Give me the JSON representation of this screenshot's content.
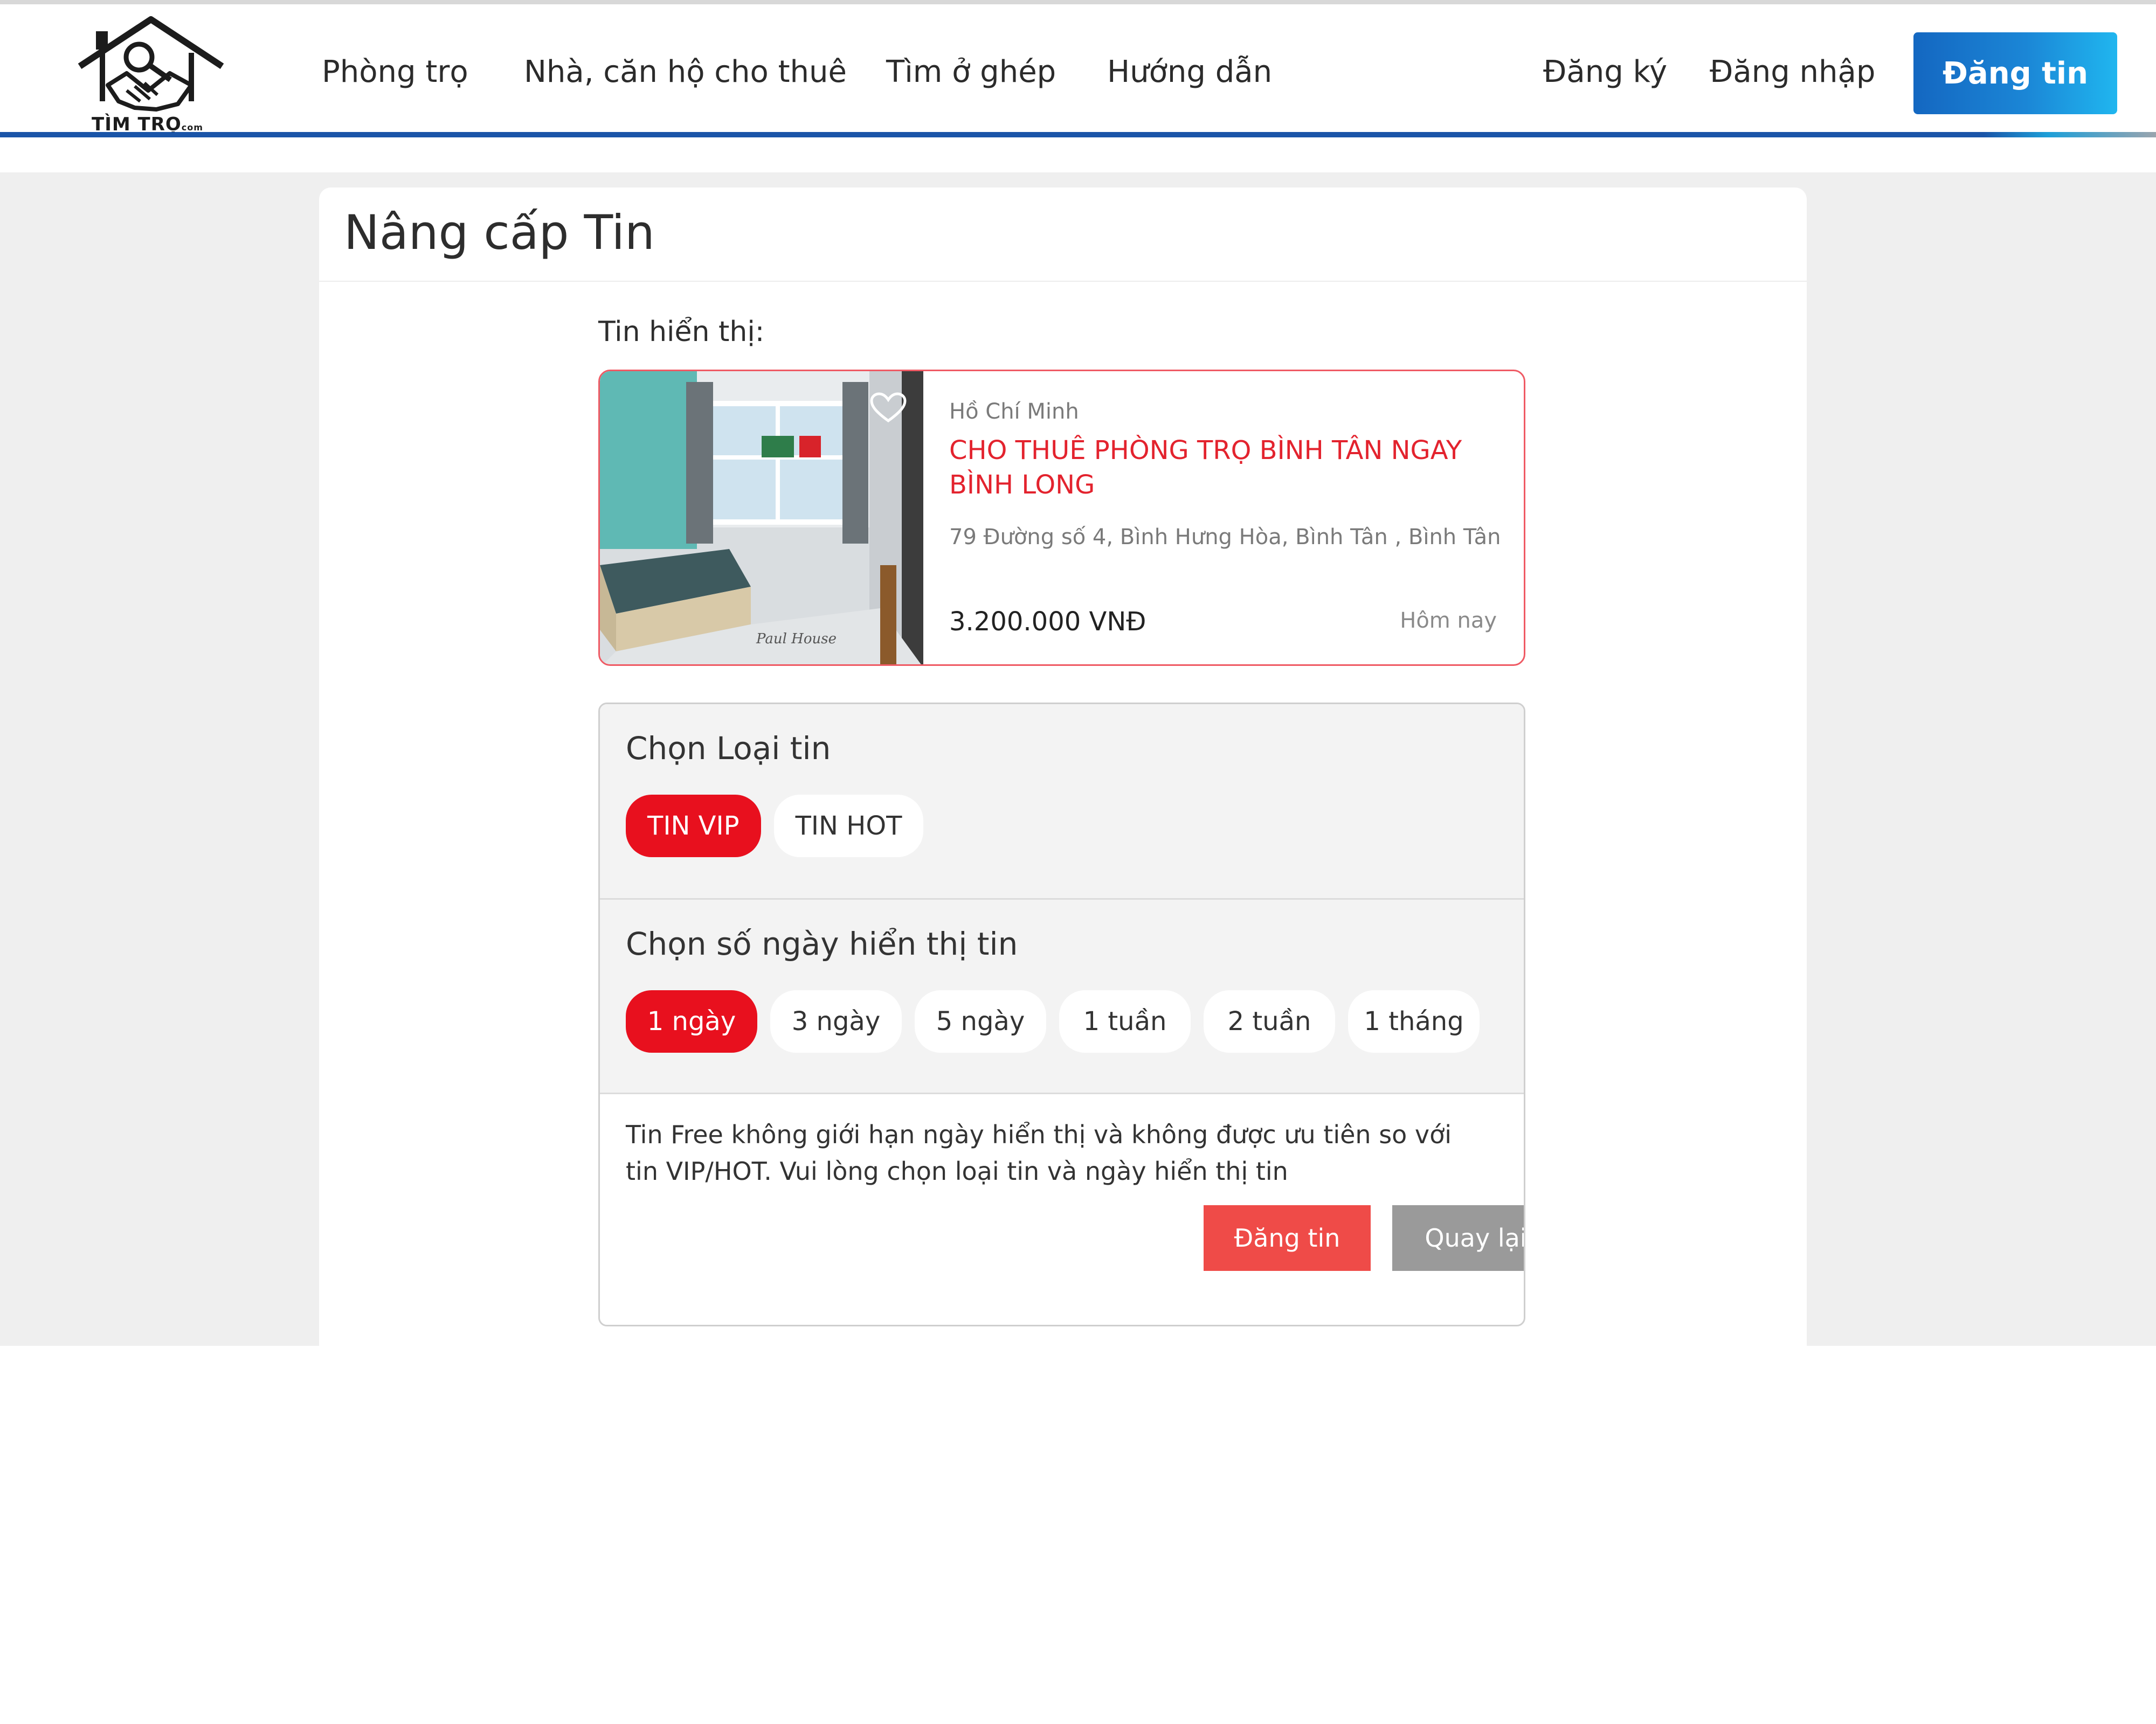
{
  "header": {
    "logo_text": "TÌM TRỌ",
    "logo_suffix": "com",
    "nav": [
      {
        "label": "Phòng trọ"
      },
      {
        "label": "Nhà, căn hộ cho thuê"
      },
      {
        "label": "Tìm ở ghép"
      },
      {
        "label": "Hướng dẫn"
      }
    ],
    "register_label": "Đăng ký",
    "login_label": "Đăng nhập",
    "post_label": "Đăng tin",
    "colors": {
      "nav_underline": "#1a55a8",
      "post_button": "#1b86d6"
    }
  },
  "panel": {
    "title": "Nâng cấp Tin",
    "shown_label": "Tin hiển thị:"
  },
  "listing": {
    "city": "Hồ Chí Minh",
    "title": "CHO THUÊ PHÒNG TRỌ BÌNH TÂN NGAY BÌNH LONG",
    "address": "79 Đường số 4, Bình Hưng Hòa, Bình Tân , Bình Tân",
    "price": "3.200.000 VNĐ",
    "time": "Hôm nay",
    "image_caption": "Paul House",
    "accent_color": "#e3232e"
  },
  "options": {
    "type_heading": "Chọn Loại tin",
    "types": [
      {
        "label": "TIN VIP",
        "active": true
      },
      {
        "label": "TIN HOT",
        "active": false
      }
    ],
    "days_heading": "Chọn số ngày hiển thị tin",
    "days": [
      {
        "label": "1 ngày",
        "active": true
      },
      {
        "label": "3 ngày",
        "active": false
      },
      {
        "label": "5 ngày",
        "active": false
      },
      {
        "label": "1 tuần",
        "active": false
      },
      {
        "label": "2 tuần",
        "active": false
      },
      {
        "label": "1 tháng",
        "active": false
      }
    ],
    "notice": "Tin Free không giới hạn ngày hiển thị và không được ưu tiên so với tin VIP/HOT. Vui lòng chọn loại tin và ngày hiển thị tin",
    "submit_label": "Đăng tin",
    "back_label": "Quay lại",
    "active_color": "#e8101e"
  }
}
